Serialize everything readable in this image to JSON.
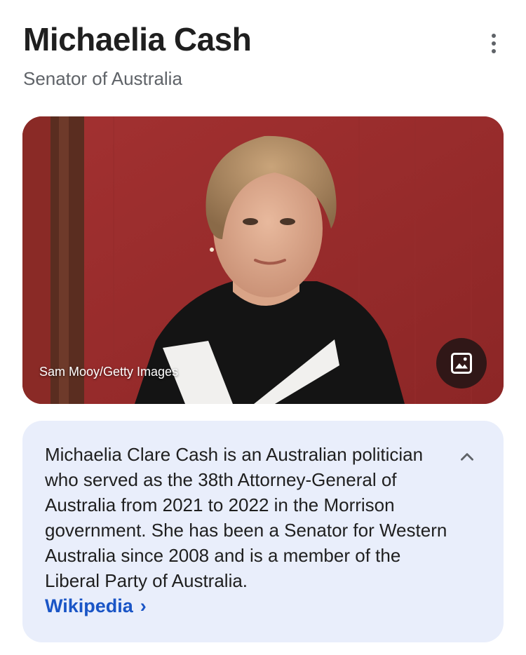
{
  "header": {
    "title": "Michaelia Cash",
    "subtitle": "Senator of Australia",
    "menu_icon": "more-vert-icon"
  },
  "image": {
    "credit": "Sam Mooy/Getty Images",
    "button_icon": "image-icon"
  },
  "description": {
    "text": "Michaelia Clare Cash is an Australian politician who served as the 38th Attorney-General of Australia from 2021 to 2022 in the Morrison government. She has been a Senator for Western Australia since 2008 and is a member of the Liberal Party of Australia.",
    "source_label": "Wikipedia",
    "source_chevron": "›",
    "collapse_icon": "chevron-up-icon"
  },
  "colors": {
    "card_background": "#e9eefb",
    "link": "#1a55c6",
    "photo_background": "#9b2b2b"
  }
}
